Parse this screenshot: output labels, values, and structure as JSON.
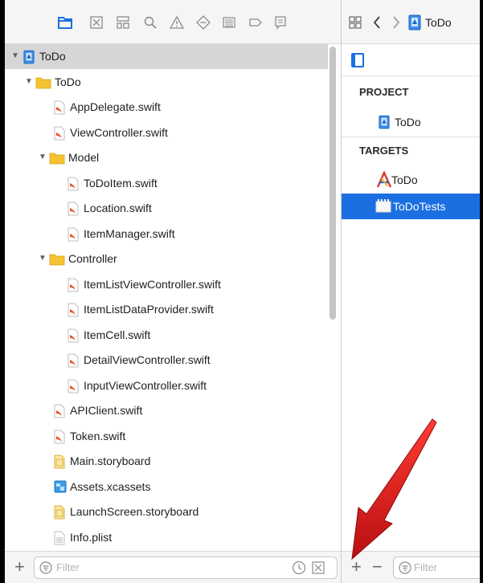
{
  "navigator": {
    "toolbar_icons": [
      "folder-icon",
      "source-control-icon",
      "symbol-icon",
      "find-icon",
      "issue-icon",
      "test-icon",
      "debug-icon",
      "breakpoint-icon",
      "report-icon"
    ],
    "items": [
      {
        "label": "ToDo",
        "icon": "project-icon",
        "depth": 0,
        "disclosure": "open",
        "selected": true
      },
      {
        "label": "ToDo",
        "icon": "folder-icon",
        "depth": 1,
        "disclosure": "open"
      },
      {
        "label": "AppDelegate.swift",
        "icon": "swift-file-icon",
        "depth": 2
      },
      {
        "label": "ViewController.swift",
        "icon": "swift-file-icon",
        "depth": 2
      },
      {
        "label": "Model",
        "icon": "folder-icon",
        "depth": 2,
        "disclosure": "open"
      },
      {
        "label": "ToDoItem.swift",
        "icon": "swift-file-icon",
        "depth": 3
      },
      {
        "label": "Location.swift",
        "icon": "swift-file-icon",
        "depth": 3
      },
      {
        "label": "ItemManager.swift",
        "icon": "swift-file-icon",
        "depth": 3
      },
      {
        "label": "Controller",
        "icon": "folder-icon",
        "depth": 2,
        "disclosure": "open"
      },
      {
        "label": "ItemListViewController.swift",
        "icon": "swift-file-icon",
        "depth": 3
      },
      {
        "label": "ItemListDataProvider.swift",
        "icon": "swift-file-icon",
        "depth": 3
      },
      {
        "label": "ItemCell.swift",
        "icon": "swift-file-icon",
        "depth": 3
      },
      {
        "label": "DetailViewController.swift",
        "icon": "swift-file-icon",
        "depth": 3
      },
      {
        "label": "InputViewController.swift",
        "icon": "swift-file-icon",
        "depth": 3
      },
      {
        "label": "APIClient.swift",
        "icon": "swift-file-icon",
        "depth": 2
      },
      {
        "label": "Token.swift",
        "icon": "swift-file-icon",
        "depth": 2
      },
      {
        "label": "Main.storyboard",
        "icon": "storyboard-icon",
        "depth": 2
      },
      {
        "label": "Assets.xcassets",
        "icon": "assets-icon",
        "depth": 2
      },
      {
        "label": "LaunchScreen.storyboard",
        "icon": "storyboard-icon",
        "depth": 2
      },
      {
        "label": "Info.plist",
        "icon": "plist-icon",
        "depth": 2
      }
    ],
    "filter_placeholder": "Filter",
    "add_label": "+"
  },
  "jumpbar": {
    "title": "ToDo"
  },
  "targets_panel": {
    "project_header": "PROJECT",
    "project_items": [
      {
        "label": "ToDo",
        "icon": "project-icon"
      }
    ],
    "targets_header": "TARGETS",
    "target_items": [
      {
        "label": "ToDo",
        "icon": "app-target-icon",
        "selected": false
      },
      {
        "label": "ToDoTests",
        "icon": "test-bundle-icon",
        "selected": true
      }
    ],
    "add_label": "+",
    "remove_label": "−",
    "filter_placeholder": "Filter"
  },
  "colors": {
    "selection_blue": "#1b6fe0",
    "folder_yellow": "#f5c231",
    "swift_orange": "#e8542d",
    "arrow_red": "#d9161a"
  }
}
